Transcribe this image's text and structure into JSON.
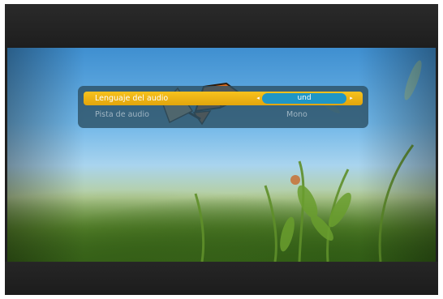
{
  "osd_menu": {
    "rows": [
      {
        "label": "Lenguaje del audio",
        "value": "und",
        "selected": true
      },
      {
        "label": "Pista de audio",
        "value": "Mono",
        "selected": false
      }
    ],
    "left_arrow_icon": "◂",
    "right_arrow_icon": "▸"
  },
  "colors": {
    "highlight": "#f2b515",
    "value_pill": "#1f96c6",
    "panel": "#2d5266"
  }
}
